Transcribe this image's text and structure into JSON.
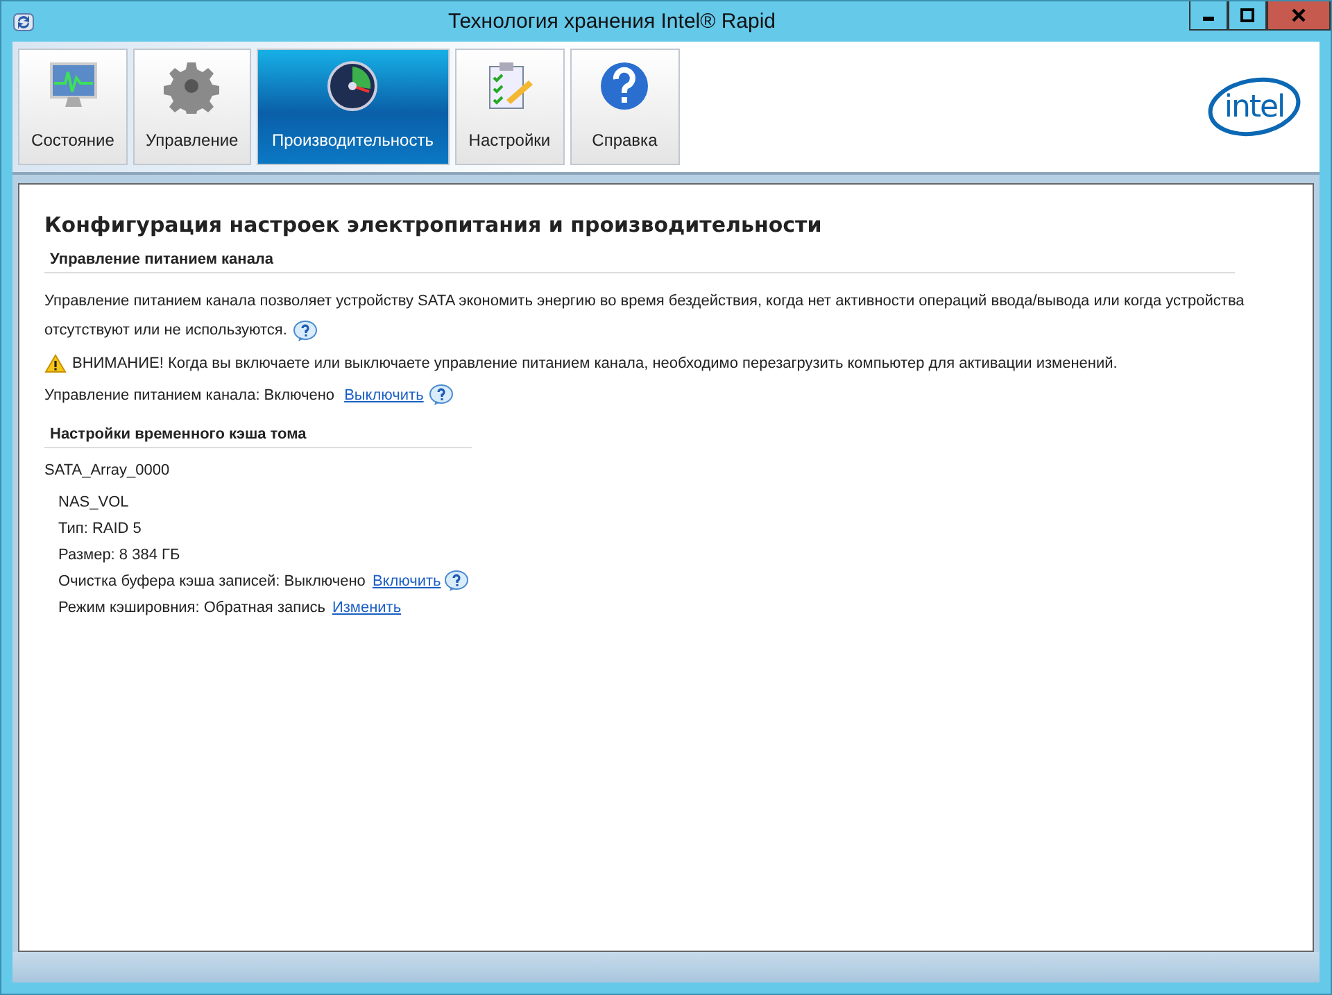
{
  "window": {
    "title": "Технология хранения Intel® Rapid"
  },
  "tabs": [
    {
      "label": "Состояние",
      "selected": false
    },
    {
      "label": "Управление",
      "selected": false
    },
    {
      "label": "Производительность",
      "selected": true
    },
    {
      "label": "Настройки",
      "selected": false
    },
    {
      "label": "Справка",
      "selected": false
    }
  ],
  "logo": "intel",
  "page": {
    "title": "Конфигурация настроек электропитания и производительности",
    "link_power": {
      "heading": "Управление питанием канала",
      "description_lines": [
        "Управление питанием канала позволяет устройству SATA экономить энергию во время бездействия, когда нет активности операций ввода/вывода или когда устройства",
        "отсутствуют или не используются."
      ],
      "warning": "ВНИМАНИЕ! Когда вы включаете или выключаете управление питанием канала, необходимо перезагрузить компьютер для активации изменений.",
      "status": "Управление питанием канала: Включено",
      "action": "Выключить"
    },
    "cache": {
      "heading": "Настройки временного кэша тома",
      "array": "SATA_Array_0000",
      "volume": "NAS_VOL",
      "rows": [
        {
          "text": "Тип: RAID 5",
          "help": false
        },
        {
          "text": "Размер: 8 384 ГБ",
          "help": false
        },
        {
          "text": "Очистка буфера кэша записей: Выключено",
          "link": "Включить",
          "help": true
        },
        {
          "text": "Режим кэшировния: Обратная запись",
          "link": "Изменить",
          "help": false
        }
      ]
    }
  }
}
